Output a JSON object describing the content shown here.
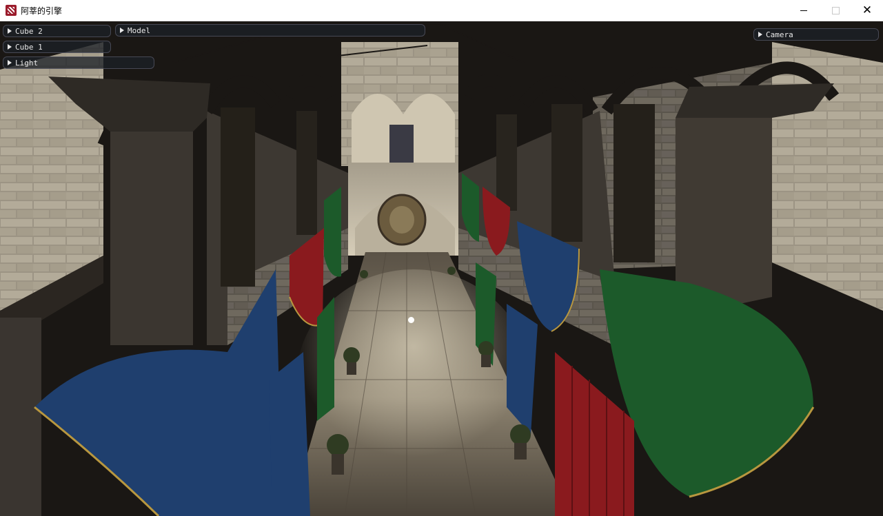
{
  "window": {
    "title": "阿莘的引擎",
    "icon": "app-logo-icon",
    "controls": {
      "minimize": "minimize-icon",
      "maximize": "maximize-icon",
      "close": "close-icon"
    }
  },
  "panels": [
    {
      "label": "Cube 2",
      "icon": "expand-arrow-icon",
      "collapsed": true
    },
    {
      "label": "Cube 1",
      "icon": "expand-arrow-icon",
      "collapsed": true
    },
    {
      "label": "Light",
      "icon": "expand-arrow-icon",
      "collapsed": true
    },
    {
      "label": "Model",
      "icon": "expand-arrow-icon",
      "collapsed": true
    },
    {
      "label": "Camera",
      "icon": "expand-arrow-icon",
      "collapsed": true
    }
  ],
  "scene": {
    "colors": {
      "stone": "#8f877a",
      "dark_stone": "#2a2622",
      "floor": "#6e6558",
      "banner_blue": "#1f3f6e",
      "banner_green": "#1c5a2a",
      "banner_red": "#8a1a1e",
      "gold_trim": "#b8973f"
    }
  }
}
